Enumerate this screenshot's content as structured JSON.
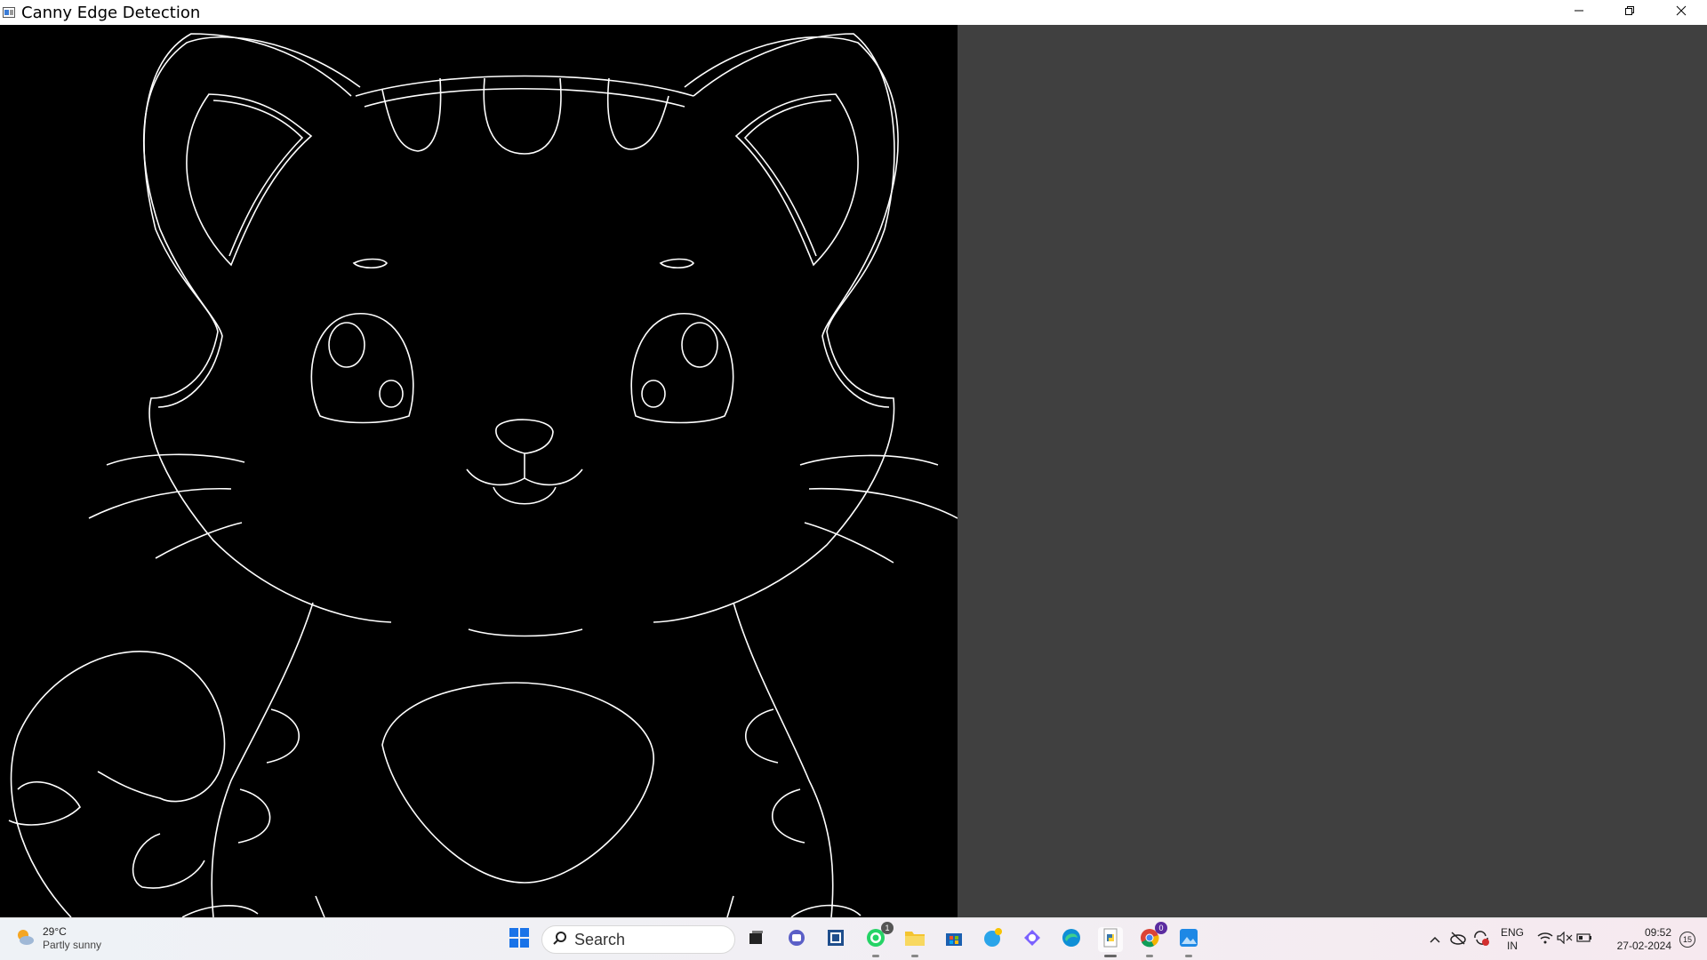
{
  "window": {
    "title": "Canny Edge Detection",
    "minimize_icon": "minimize-icon",
    "restore_icon": "restore-icon",
    "close_icon": "close-icon"
  },
  "canvas": {
    "content": "canny-edge-detection-output-cat"
  },
  "taskbar": {
    "weather": {
      "temp": "29°C",
      "desc": "Partly sunny",
      "icon": "partly-sunny-icon"
    },
    "search": {
      "label": "Search"
    },
    "apps": [
      {
        "name": "start",
        "icon": "windows-start-icon"
      },
      {
        "name": "task-view",
        "icon": "task-view-icon"
      },
      {
        "name": "teams",
        "icon": "teams-icon"
      },
      {
        "name": "widgets",
        "icon": "widgets-icon"
      },
      {
        "name": "whatsapp",
        "icon": "whatsapp-icon",
        "badge": "1"
      },
      {
        "name": "file-explorer",
        "icon": "folder-icon"
      },
      {
        "name": "store",
        "icon": "store-icon"
      },
      {
        "name": "chat",
        "icon": "chat-icon"
      },
      {
        "name": "copilot",
        "icon": "copilot-icon"
      },
      {
        "name": "edge",
        "icon": "edge-icon"
      },
      {
        "name": "python",
        "icon": "python-icon"
      },
      {
        "name": "chrome",
        "icon": "chrome-icon",
        "badge": "0"
      },
      {
        "name": "photos",
        "icon": "photos-icon"
      }
    ],
    "tray": {
      "lang_top": "ENG",
      "lang_bottom": "IN",
      "time": "09:52",
      "date": "27-02-2024",
      "notifications": "15"
    }
  },
  "colors": {
    "client_bg": "#404040",
    "canvas_bg": "#000000",
    "edge_stroke": "#ffffff"
  }
}
